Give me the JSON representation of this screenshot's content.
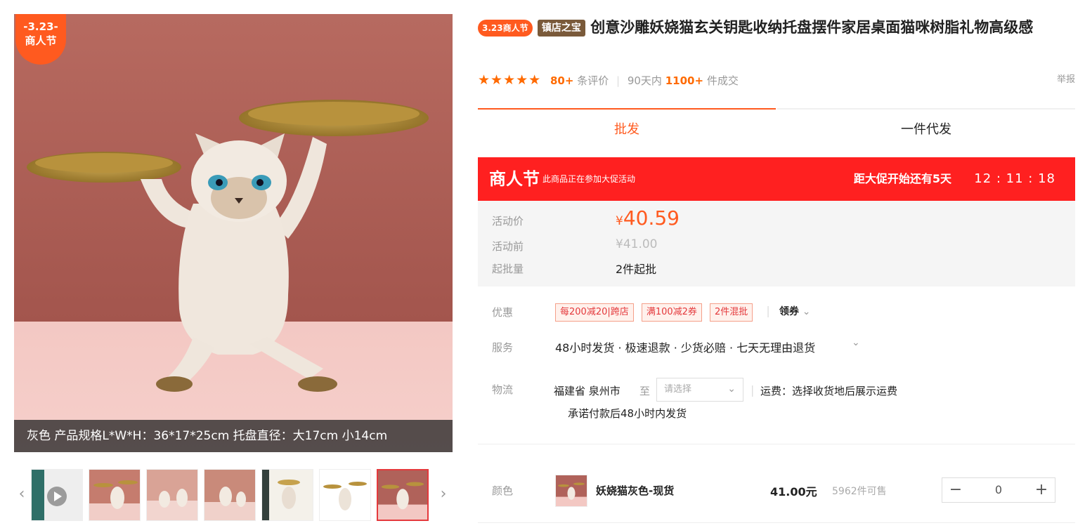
{
  "promo_badge": {
    "date": "-3.23-",
    "label": "商人节"
  },
  "image_caption": "灰色 产品规格L*W*H：36*17*25cm 托盘直径：大17cm 小14cm",
  "thumbnails": [
    "video",
    "cat-1",
    "cat-2",
    "cat-3",
    "cat-4",
    "cat-5",
    "cat-6"
  ],
  "product": {
    "tag_festival": "3.23商人节",
    "tag_shop": "镇店之宝",
    "title": "创意沙雕妖娆猫玄关钥匙收纳托盘摆件家居桌面猫咪树脂礼物高级感"
  },
  "rating": {
    "stars": "★★★★★",
    "review_count": "80+",
    "review_label": "条评价",
    "sales_period": "90天内",
    "sales_count": "1100+",
    "sales_label": "件成交",
    "report": "举报"
  },
  "tabs": {
    "wholesale": "批发",
    "dropship": "一件代发"
  },
  "promo_bar": {
    "title": "商人节",
    "subtitle": "此商品正在参加大促活动",
    "countdown_label": "距大促开始还有5天",
    "countdown": "12 : 11 : 18"
  },
  "price": {
    "activity_label": "活动价",
    "currency": "¥",
    "activity_price": "40.59",
    "before_label": "活动前",
    "before_price": "¥41.00",
    "moq_label": "起批量",
    "moq": "2件起批"
  },
  "discount": {
    "label": "优惠",
    "coupons": [
      "每200减20|跨店",
      "满100减2券",
      "2件混批"
    ],
    "get_coupon": "领券"
  },
  "service": {
    "label": "服务",
    "text": "48小时发货 · 极速退款 · 少货必赔 · 七天无理由退货"
  },
  "logistics": {
    "label": "物流",
    "origin": "福建省 泉州市",
    "to": "至",
    "select_placeholder": "请选择",
    "shipping": "运费：选择收货地后展示运费",
    "promise": "承诺付款后48小时内发货"
  },
  "variant": {
    "label": "颜色",
    "name": "妖娆猫灰色-现货",
    "price": "41.00元",
    "stock": "5962件可售",
    "quantity": "0",
    "minus": "−",
    "plus": "+"
  },
  "colors": {
    "accent": "#ff6a00",
    "promo_red": "#ff2020",
    "image_bg": "#b0625a"
  }
}
